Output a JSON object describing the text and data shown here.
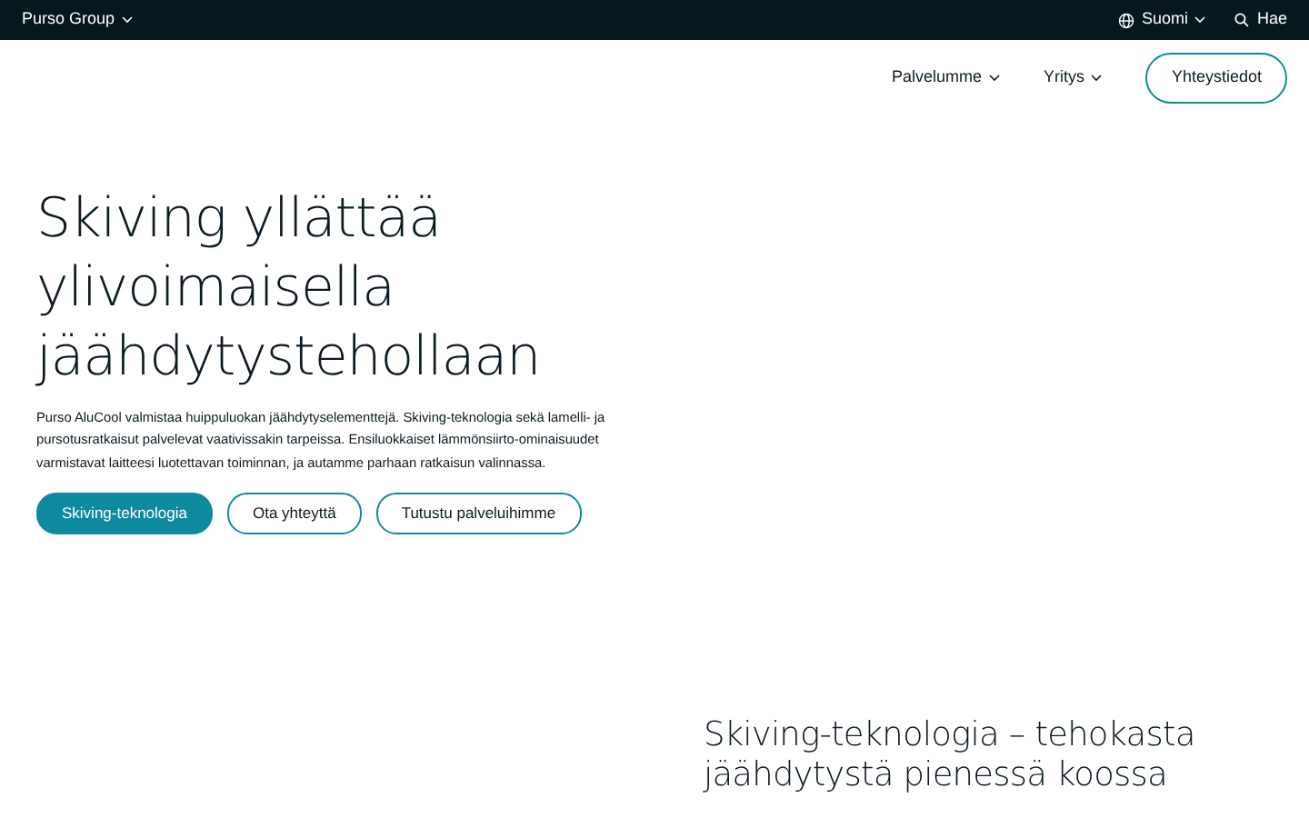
{
  "top_bar": {
    "brand": "Purso Group",
    "language": "Suomi",
    "search": "Hae"
  },
  "nav": {
    "items": [
      {
        "label": "Palvelumme"
      },
      {
        "label": "Yritys"
      }
    ],
    "contact_button": "Yhteystiedot"
  },
  "hero": {
    "title": "Skiving yllättää ylivoimaisella jäähdytystehollaan",
    "text": "Purso AluCool valmistaa huippuluokan jäähdytyselementtejä. Skiving-teknologia sekä lamelli- ja pursotusratkaisut palvelevat vaativissakin tarpeissa. Ensiluokkaiset lämmönsiirto-ominaisuudet varmistavat laitteesi luotettavan toiminnan, ja autamme parhaan ratkaisun valinnassa.",
    "buttons": [
      {
        "label": "Skiving-teknologia",
        "kind": "primary"
      },
      {
        "label": "Ota yhteyttä",
        "kind": "outline"
      },
      {
        "label": "Tutustu palveluihimme",
        "kind": "outline"
      }
    ]
  },
  "section": {
    "title": "Skiving-teknologia – tehokasta jäähdytystä pienessä koossa"
  }
}
